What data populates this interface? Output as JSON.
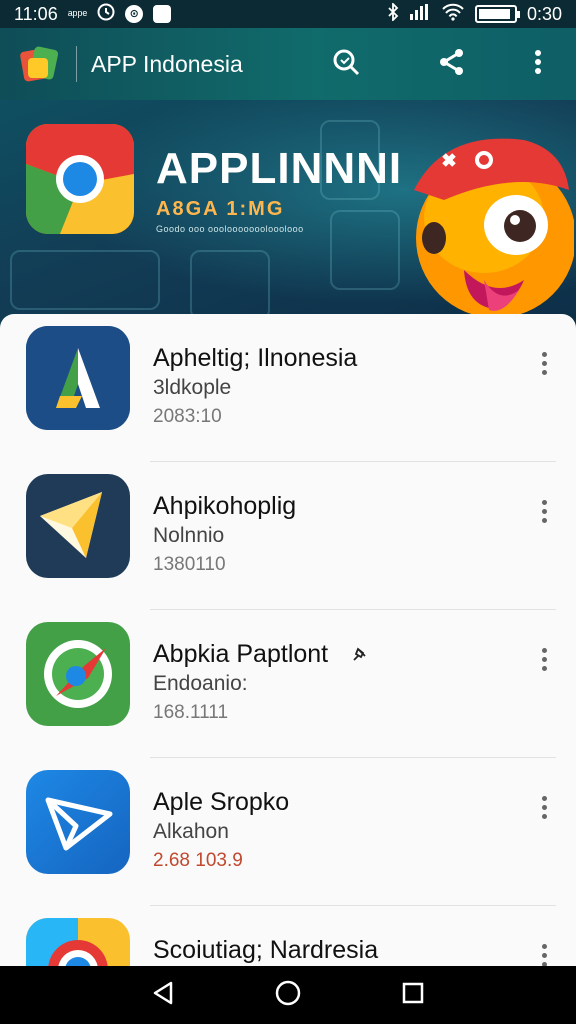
{
  "status_bar": {
    "time_left": "11:06",
    "carrier": "ᵃᵖᵖᵉ",
    "time_right": "0:30"
  },
  "app_bar": {
    "title": "APP Indonesia",
    "icons": [
      "search-icon",
      "share-icon",
      "more-vertical-icon"
    ]
  },
  "banner": {
    "headline": "APPLINNNI",
    "subheadline": "A8GA 1:MG",
    "tagline": "Goodo ooo ooolooooooolooolooo"
  },
  "apps": [
    {
      "title": "Apheltiɡ; Ilnonesia",
      "subtitle": "3ldkople",
      "meta": "2083:10",
      "meta_color": "#777777",
      "icon": "launcher-a-icon"
    },
    {
      "title": "Ahpikohoplig",
      "subtitle": "Nolnnio",
      "meta": "1380110",
      "meta_color": "#777777",
      "icon": "paper-plane-icon"
    },
    {
      "title": "Abpkia Paptlont",
      "subtitle": "Endoanio:",
      "meta": "168.1111",
      "meta_color": "#777777",
      "icon": "compass-icon"
    },
    {
      "title": "Aple Sropko",
      "subtitle": "Alkahon",
      "meta": "2.68 103.9",
      "meta_color": "#e8533a",
      "icon": "send-icon"
    },
    {
      "title": "Scoiutiag; Nardresia",
      "subtitle": "",
      "meta": "",
      "meta_color": "#777777",
      "icon": "browser-icon"
    }
  ],
  "colors": {
    "app_bar": "#106b6b",
    "banner": "#123c55",
    "list_bg": "#fafafa"
  }
}
